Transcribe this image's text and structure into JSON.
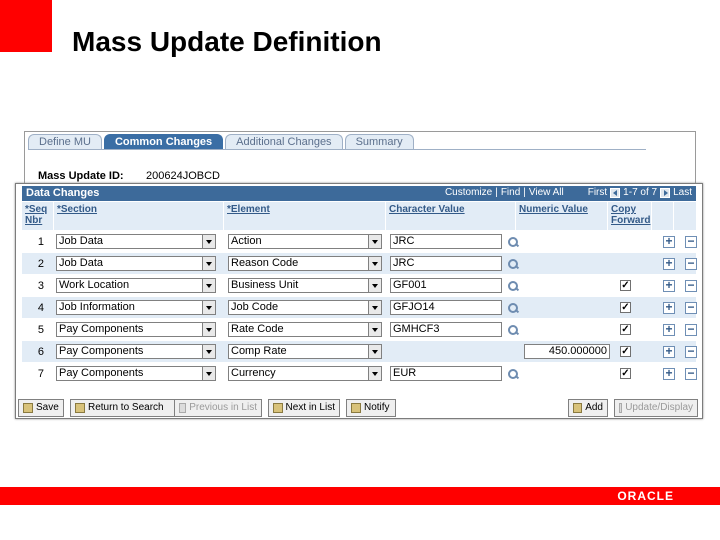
{
  "slide": {
    "title": "Mass Update Definition",
    "footer_logo": "ORACLE"
  },
  "tabs": [
    {
      "label": "Define MU",
      "active": false
    },
    {
      "label": "Common Changes",
      "active": true
    },
    {
      "label": "Additional Changes",
      "active": false
    },
    {
      "label": "Summary",
      "active": false
    }
  ],
  "mass_update": {
    "label": "Mass Update ID:",
    "value": "200624JOBCD"
  },
  "grid": {
    "title": "Data Changes",
    "nav": {
      "customize": "Customize",
      "find": "Find",
      "view_all": "View All",
      "first": "First",
      "range": "1-7 of 7",
      "last": "Last"
    },
    "columns": {
      "seq": "*Seq Nbr",
      "section": "*Section",
      "element": "*Element",
      "char_value": "Character Value",
      "num_value": "Numeric Value",
      "copy_forward": "Copy Forward"
    },
    "rows": [
      {
        "seq": "1",
        "section": "Job Data",
        "element": "Action",
        "char": "JRC",
        "has_char": true,
        "num": "",
        "has_num": false,
        "copy": "",
        "has_copy": false
      },
      {
        "seq": "2",
        "section": "Job Data",
        "element": "Reason Code",
        "char": "JRC",
        "has_char": true,
        "num": "",
        "has_num": false,
        "copy": "",
        "has_copy": false
      },
      {
        "seq": "3",
        "section": "Work Location",
        "element": "Business Unit",
        "char": "GF001",
        "has_char": true,
        "num": "",
        "has_num": false,
        "copy": "✓",
        "has_copy": true
      },
      {
        "seq": "4",
        "section": "Job Information",
        "element": "Job Code",
        "char": "GFJO14",
        "has_char": true,
        "num": "",
        "has_num": false,
        "copy": "✓",
        "has_copy": true
      },
      {
        "seq": "5",
        "section": "Pay Components",
        "element": "Rate Code",
        "char": "GMHCF3",
        "has_char": true,
        "num": "",
        "has_num": false,
        "copy": "✓",
        "has_copy": true
      },
      {
        "seq": "6",
        "section": "Pay Components",
        "element": "Comp Rate",
        "char": "",
        "has_char": false,
        "num": "450.000000",
        "has_num": true,
        "copy": "✓",
        "has_copy": true
      },
      {
        "seq": "7",
        "section": "Pay Components",
        "element": "Currency",
        "char": "EUR",
        "has_char": true,
        "num": "",
        "has_num": false,
        "copy": "✓",
        "has_copy": true
      }
    ],
    "add_symbol": "+",
    "delete_symbol": "−"
  },
  "buttons": {
    "save": "Save",
    "return_to_search": "Return to Search",
    "previous_in_list": "Previous in List",
    "next_in_list": "Next in List",
    "notify": "Notify",
    "add": "Add",
    "update_display": "Update/Display"
  }
}
